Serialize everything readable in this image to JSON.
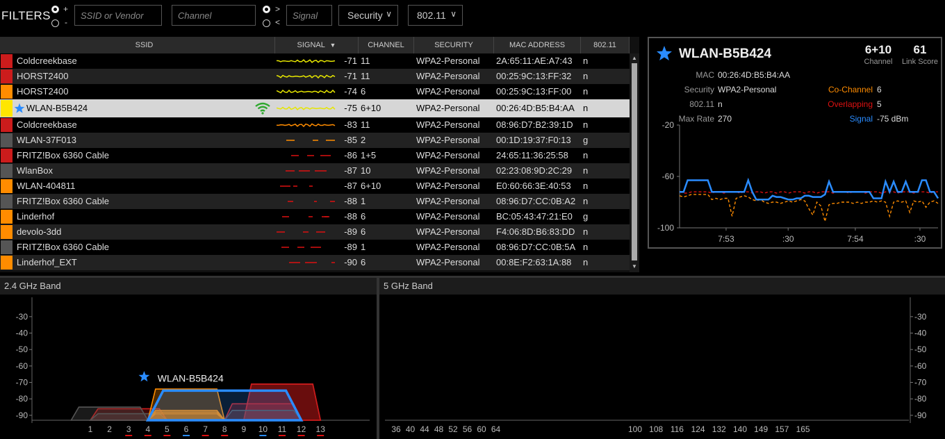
{
  "filters": {
    "title": "FILTERS",
    "op1_plus": "+",
    "op1_minus": "-",
    "ssid_placeholder": "SSID or Vendor",
    "channel_placeholder": "Channel",
    "op2_gt": ">",
    "op2_lt": "<",
    "signal_placeholder": "Signal",
    "security_label": "Security",
    "mode_label": "802.11"
  },
  "table": {
    "headers": [
      "SSID",
      "SIGNAL",
      "CHANNEL",
      "SECURITY",
      "MAC ADDRESS",
      "802.11"
    ],
    "rows": [
      {
        "ssid": "Coldcreekbase",
        "signal": "-71",
        "channel": "11",
        "security": "WPA2-Personal",
        "mac": "2A:65:11:AE:A7:43",
        "mode": "n",
        "color": "#cc1c1c",
        "spark": "#e6e600"
      },
      {
        "ssid": "HORST2400",
        "signal": "-71",
        "channel": "11",
        "security": "WPA2-Personal",
        "mac": "00:25:9C:13:FF:32",
        "mode": "n",
        "color": "#cc1c1c",
        "spark": "#e6e600"
      },
      {
        "ssid": "HORST2400",
        "signal": "-74",
        "channel": "6",
        "security": "WPA2-Personal",
        "mac": "00:25:9C:13:FF:00",
        "mode": "n",
        "color": "#ff8c00",
        "spark": "#e6e600"
      },
      {
        "ssid": "WLAN-B5B424",
        "signal": "-75",
        "channel": "6+10",
        "security": "WPA2-Personal",
        "mac": "00:26:4D:B5:B4:AA",
        "mode": "n",
        "color": "#ffe600",
        "spark": "#e6e600",
        "selected": true
      },
      {
        "ssid": "Coldcreekbase",
        "signal": "-83",
        "channel": "11",
        "security": "WPA2-Personal",
        "mac": "08:96:D7:B2:39:1D",
        "mode": "n",
        "color": "#cc1c1c",
        "spark": "#ff8c00"
      },
      {
        "ssid": "WLAN-37F013",
        "signal": "-85",
        "channel": "2",
        "security": "WPA2-Personal",
        "mac": "00:1D:19:37:F0:13",
        "mode": "g",
        "color": "#555555",
        "spark": "#ff8c00"
      },
      {
        "ssid": "FRITZ!Box 6360 Cable",
        "signal": "-86",
        "channel": "1+5",
        "security": "WPA2-Personal",
        "mac": "24:65:11:36:25:58",
        "mode": "n",
        "color": "#cc1c1c",
        "spark": "#dd1111"
      },
      {
        "ssid": "WlanBox",
        "signal": "-87",
        "channel": "10",
        "security": "WPA2-Personal",
        "mac": "02:23:08:9D:2C:29",
        "mode": "n",
        "color": "#555555",
        "spark": "#dd1111"
      },
      {
        "ssid": "WLAN-404811",
        "signal": "-87",
        "channel": "6+10",
        "security": "WPA2-Personal",
        "mac": "E0:60:66:3E:40:53",
        "mode": "n",
        "color": "#ff8c00",
        "spark": "#dd1111"
      },
      {
        "ssid": "FRITZ!Box 6360 Cable",
        "signal": "-88",
        "channel": "1",
        "security": "WPA2-Personal",
        "mac": "08:96:D7:CC:0B:A2",
        "mode": "n",
        "color": "#555555",
        "spark": "#dd1111"
      },
      {
        "ssid": "Linderhof",
        "signal": "-88",
        "channel": "6",
        "security": "WPA2-Personal",
        "mac": "BC:05:43:47:21:E0",
        "mode": "g",
        "color": "#ff8c00",
        "spark": "#dd1111"
      },
      {
        "ssid": "devolo-3dd",
        "signal": "-89",
        "channel": "6",
        "security": "WPA2-Personal",
        "mac": "F4:06:8D:B6:83:DD",
        "mode": "n",
        "color": "#ff8c00",
        "spark": "#dd1111"
      },
      {
        "ssid": "FRITZ!Box 6360 Cable",
        "signal": "-89",
        "channel": "1",
        "security": "WPA2-Personal",
        "mac": "08:96:D7:CC:0B:5A",
        "mode": "n",
        "color": "#555555",
        "spark": "#dd1111"
      },
      {
        "ssid": "Linderhof_EXT",
        "signal": "-90",
        "channel": "6",
        "security": "WPA2-Personal",
        "mac": "00:8E:F2:63:1A:88",
        "mode": "n",
        "color": "#ff8c00",
        "spark": "#dd1111"
      }
    ]
  },
  "detail": {
    "ssid": "WLAN-B5B424",
    "channel_value": "6+10",
    "channel_label": "Channel",
    "link_score_value": "61",
    "link_score_label": "Link Score",
    "mac_label": "MAC",
    "mac_value": "00:26:4D:B5:B4:AA",
    "security_label": "Security",
    "security_value": "WPA2-Personal",
    "mode_label": "802.11",
    "mode_value": "n",
    "max_rate_label": "Max Rate",
    "max_rate_value": "270",
    "cochannel_label": "Co-Channel",
    "cochannel_value": "6",
    "overlapping_label": "Overlapping",
    "overlapping_value": "5",
    "signal_label": "Signal",
    "signal_value": "-75 dBm",
    "colors": {
      "cochannel": "#ff8c00",
      "overlapping": "#dd1111",
      "signal": "#2a8cff"
    }
  },
  "chart_data": [
    {
      "type": "line",
      "title": "",
      "ylim": [
        -100,
        -20
      ],
      "yticks": [
        "-20",
        "-60",
        "-100"
      ],
      "xticks": [
        "7:53",
        ":30",
        "7:54",
        ":30"
      ],
      "series": [
        {
          "name": "Signal",
          "color": "#2a8cff",
          "values": [
            -72,
            -72,
            -63,
            -63,
            -63,
            -63,
            -63,
            -63,
            -72,
            -72,
            -72,
            -72,
            -72,
            -72,
            -72,
            -72,
            -72,
            -63,
            -72,
            -78,
            -78,
            -78,
            -78,
            -75,
            -76,
            -76,
            -77,
            -78,
            -78,
            -77,
            -77,
            -75,
            -75,
            -76,
            -76,
            -76,
            -74,
            -64,
            -72,
            -72,
            -72,
            -72,
            -72,
            -72,
            -72,
            -72,
            -72,
            -72,
            -77,
            -77,
            -77,
            -64,
            -72,
            -64,
            -72,
            -72,
            -64,
            -72,
            -72,
            -72,
            -63,
            -63,
            -72,
            -72,
            -77
          ]
        },
        {
          "name": "Co-Channel",
          "color": "#ff8c00",
          "values": [
            -75,
            -76,
            -75,
            -74,
            -74,
            -74,
            -74,
            -74,
            -78,
            -77,
            -78,
            -77,
            -77,
            -91,
            -77,
            -76,
            -75,
            -76,
            -78,
            -79,
            -78,
            -80,
            -81,
            -80,
            -80,
            -81,
            -80,
            -79,
            -80,
            -79,
            -78,
            -79,
            -85,
            -90,
            -80,
            -83,
            -95,
            -82,
            -81,
            -81,
            -80,
            -80,
            -80,
            -81,
            -80,
            -81,
            -80,
            -80,
            -79,
            -80,
            -79,
            -80,
            -91,
            -80,
            -79,
            -80,
            -79,
            -88,
            -79,
            -80,
            -79,
            -84,
            -80,
            -79,
            -81
          ]
        },
        {
          "name": "Overlapping",
          "color": "#dd1111",
          "values": [
            -72,
            -73,
            -73,
            -72,
            -72,
            -72,
            -72,
            -72,
            -73,
            -72,
            -72,
            -73,
            -72,
            -72,
            -72,
            -73,
            -72,
            -72,
            -73,
            -72,
            -72,
            -73,
            -72,
            -72,
            -73,
            -72,
            -72,
            -73,
            -72,
            -72,
            -72,
            -73,
            -72,
            -72,
            -73,
            -72,
            -72,
            -72,
            -73,
            -72,
            -72,
            -72,
            -73,
            -72,
            -72,
            -72,
            -73,
            -72,
            -72,
            -72,
            -73,
            -72,
            -72,
            -72,
            -73,
            -72,
            -72,
            -72,
            -73,
            -72,
            -72,
            -72,
            -73,
            -72,
            -72
          ]
        }
      ]
    },
    {
      "type": "area",
      "title": "2.4 GHz Band",
      "ylim": [
        -93,
        -25
      ],
      "yticks": [
        "-30",
        "-40",
        "-50",
        "-60",
        "-70",
        "-80",
        "-90"
      ],
      "channels": [
        "1",
        "2",
        "3",
        "4",
        "5",
        "6",
        "7",
        "8",
        "9",
        "10",
        "11",
        "12",
        "13"
      ],
      "networks": [
        {
          "from": 1,
          "to": 5,
          "level": -86,
          "color": "#cc1c1c"
        },
        {
          "from": 1,
          "to": 5,
          "level": -89,
          "color": "#555555"
        },
        {
          "from": 0,
          "to": 4,
          "level": -85,
          "color": "#555555"
        },
        {
          "from": 4,
          "to": 8,
          "level": -74,
          "color": "#ff8c00"
        },
        {
          "from": 4,
          "to": 8,
          "level": -87,
          "color": "#ff8c00"
        },
        {
          "from": 4,
          "to": 8,
          "level": -88,
          "color": "#ff8c00"
        },
        {
          "from": 4,
          "to": 8,
          "level": -89,
          "color": "#ff8c00"
        },
        {
          "from": 8,
          "to": 12,
          "level": -83,
          "color": "#cc1c1c"
        },
        {
          "from": 9,
          "to": 13,
          "level": -71,
          "color": "#cc1c1c"
        },
        {
          "from": 9,
          "to": 13,
          "level": -71,
          "color": "#cc1c1c"
        },
        {
          "from": 8,
          "to": 12,
          "level": -87,
          "color": "#555555"
        },
        {
          "from": 4,
          "to": 12,
          "level": -75,
          "color": "#2a8cff",
          "label": "WLAN-B5B424"
        }
      ],
      "channel_colors": {
        "3": "#dd1111",
        "4": "#dd1111",
        "5": "#dd1111",
        "6": "#2a8cff",
        "7": "#dd1111",
        "8": "#dd1111",
        "10": "#2a8cff",
        "11": "#dd1111",
        "12": "#dd1111",
        "13": "#dd1111"
      }
    },
    {
      "type": "area",
      "title": "5 GHz Band",
      "ylim": [
        -93,
        -25
      ],
      "yticks": [
        "-30",
        "-40",
        "-50",
        "-60",
        "-70",
        "-80",
        "-90"
      ],
      "channels": [
        "36",
        "40",
        "44",
        "48",
        "52",
        "56",
        "60",
        "64",
        "100",
        "108",
        "116",
        "124",
        "132",
        "140",
        "149",
        "157",
        "165"
      ],
      "networks": []
    }
  ]
}
